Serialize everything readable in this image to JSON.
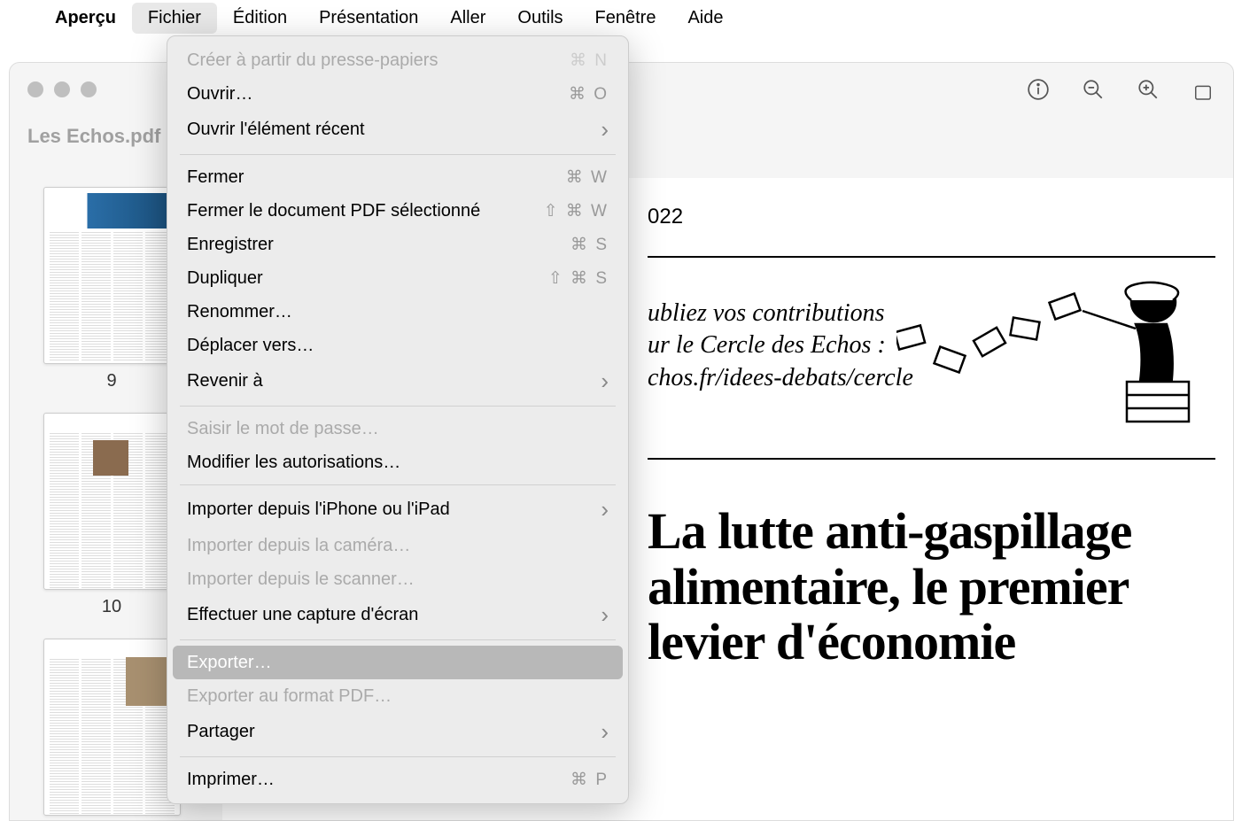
{
  "menubar": {
    "app": "Aperçu",
    "items": [
      "Fichier",
      "Édition",
      "Présentation",
      "Aller",
      "Outils",
      "Fenêtre",
      "Aide"
    ],
    "active_index": 0
  },
  "window": {
    "doc_title": "Les Echos.pdf"
  },
  "thumbnails": [
    {
      "label": "9"
    },
    {
      "label": "10"
    },
    {
      "label": ""
    }
  ],
  "dropdown": {
    "items": [
      {
        "label": "Créer à partir du presse-papiers",
        "shortcut": "⌘ N",
        "disabled": true
      },
      {
        "label": "Ouvrir…",
        "shortcut": "⌘ O"
      },
      {
        "label": "Ouvrir l'élément récent",
        "submenu": true
      },
      {
        "sep": true
      },
      {
        "label": "Fermer",
        "shortcut": "⌘ W"
      },
      {
        "label": "Fermer le document PDF sélectionné",
        "shortcut": "⇧ ⌘ W"
      },
      {
        "label": "Enregistrer",
        "shortcut": "⌘ S"
      },
      {
        "label": "Dupliquer",
        "shortcut": "⇧ ⌘ S"
      },
      {
        "label": "Renommer…"
      },
      {
        "label": "Déplacer vers…"
      },
      {
        "label": "Revenir à",
        "submenu": true
      },
      {
        "sep": true
      },
      {
        "label": "Saisir le mot de passe…",
        "disabled": true
      },
      {
        "label": "Modifier les autorisations…"
      },
      {
        "sep": true
      },
      {
        "label": "Importer depuis l'iPhone ou l'iPad",
        "submenu": true
      },
      {
        "label": "Importer depuis la caméra…",
        "disabled": true
      },
      {
        "label": "Importer depuis le scanner…",
        "disabled": true
      },
      {
        "label": "Effectuer une capture d'écran",
        "submenu": true
      },
      {
        "sep": true
      },
      {
        "label": "Exporter…",
        "highlighted": true
      },
      {
        "label": "Exporter au format PDF…",
        "disabled": true
      },
      {
        "label": "Partager",
        "submenu": true
      },
      {
        "sep": true
      },
      {
        "label": "Imprimer…",
        "shortcut": "⌘ P"
      }
    ]
  },
  "content": {
    "date_fragment": "022",
    "promo_line1": "ubliez vos contributions",
    "promo_line2": "ur le Cercle des Echos :",
    "promo_line3": "chos.fr/idees-debats/cercle",
    "headline": "La lutte anti-gaspillage alimentaire, le premier levier d'économie"
  }
}
